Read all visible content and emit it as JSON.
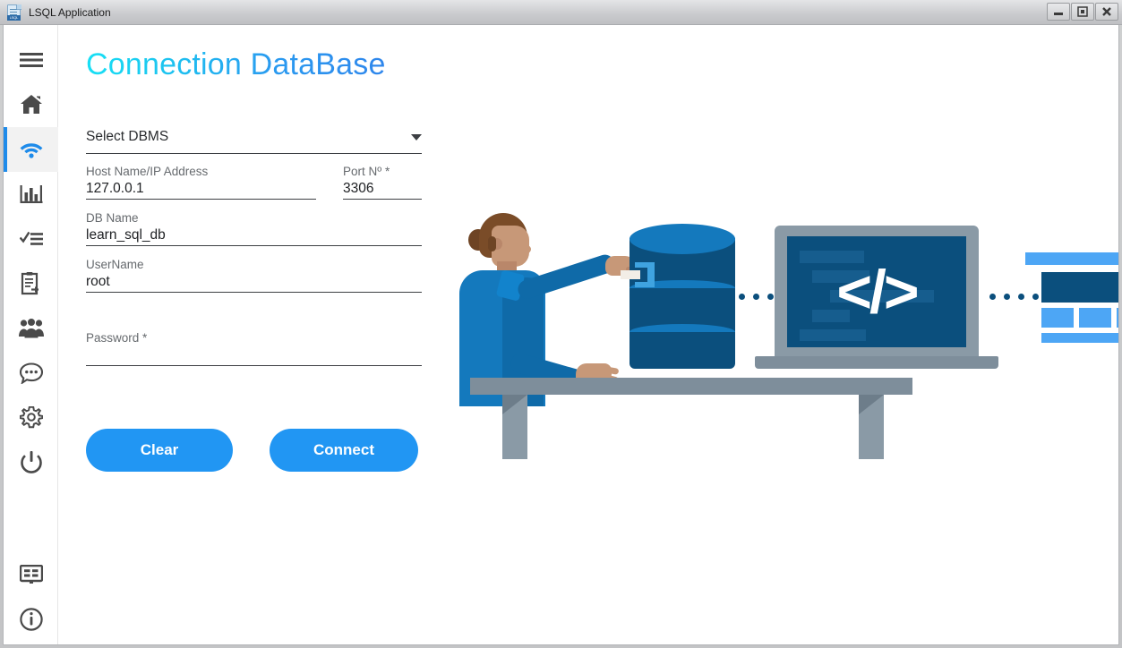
{
  "window": {
    "title": "LSQL Application",
    "icon": "lsql-document-icon",
    "icon_tag": "LSQL",
    "controls": [
      {
        "name": "minimize-button",
        "glyph": "minimize"
      },
      {
        "name": "restore-button",
        "glyph": "restore"
      },
      {
        "name": "close-button",
        "glyph": "close"
      }
    ]
  },
  "sidebar": {
    "active_index": 2,
    "accent_color": "#1e8bea",
    "active_bg": "#f2f2f2",
    "items": [
      {
        "name": "sidebar-item-menu",
        "icon": "hamburger-menu-icon",
        "label": "Menu"
      },
      {
        "name": "sidebar-item-home",
        "icon": "home-icon",
        "label": "Home"
      },
      {
        "name": "sidebar-item-connection",
        "icon": "wifi-icon",
        "label": "Connection"
      },
      {
        "name": "sidebar-item-statistics",
        "icon": "bar-chart-icon",
        "label": "Statistics"
      },
      {
        "name": "sidebar-item-tasks",
        "icon": "checklist-icon",
        "label": "Tasks"
      },
      {
        "name": "sidebar-item-queries",
        "icon": "clipboard-import-icon",
        "label": "Queries"
      },
      {
        "name": "sidebar-item-users",
        "icon": "users-group-icon",
        "label": "Users"
      },
      {
        "name": "sidebar-item-messages",
        "icon": "chat-bubble-icon",
        "label": "Messages"
      },
      {
        "name": "sidebar-item-settings",
        "icon": "gear-icon",
        "label": "Settings"
      },
      {
        "name": "sidebar-item-power",
        "icon": "power-icon",
        "label": "Exit"
      }
    ],
    "bottom_items": [
      {
        "name": "sidebar-item-display",
        "icon": "display-layout-icon",
        "label": "Display"
      },
      {
        "name": "sidebar-item-about",
        "icon": "info-circle-icon",
        "label": "About"
      }
    ]
  },
  "main": {
    "title": "Connection DataBase",
    "title_gradient": [
      "#18e0f5",
      "#2f86ec"
    ],
    "form": {
      "dbms": {
        "label": "Select DBMS",
        "selected": "Select DBMS",
        "caret": "chevron-down-icon"
      },
      "host": {
        "label": "Host Name/IP Address",
        "value": "127.0.0.1"
      },
      "port": {
        "label": "Port Nº *",
        "value": "3306"
      },
      "db_name": {
        "label": "DB Name",
        "value": "learn_sql_db"
      },
      "username": {
        "label": "UserName",
        "value": "root"
      },
      "password": {
        "label": "Password *",
        "value": ""
      }
    },
    "buttons": {
      "clear": "Clear",
      "connect": "Connect",
      "color": "#2196f3"
    }
  },
  "illustration": {
    "name": "database-connection-illustration",
    "code_glyph": "</>",
    "elements": [
      "woman-plugging-cable",
      "database-cylinder",
      "laptop-with-code",
      "web-page-mockup",
      "desk-table",
      "dotted-connector"
    ],
    "colors": {
      "db_dark": "#0b4f7d",
      "db_light": "#1479bd",
      "metal": "#8a9aa6",
      "accent_light_blue": "#4da6f5",
      "skin": "#c79878",
      "hair": "#7a4c28"
    }
  }
}
